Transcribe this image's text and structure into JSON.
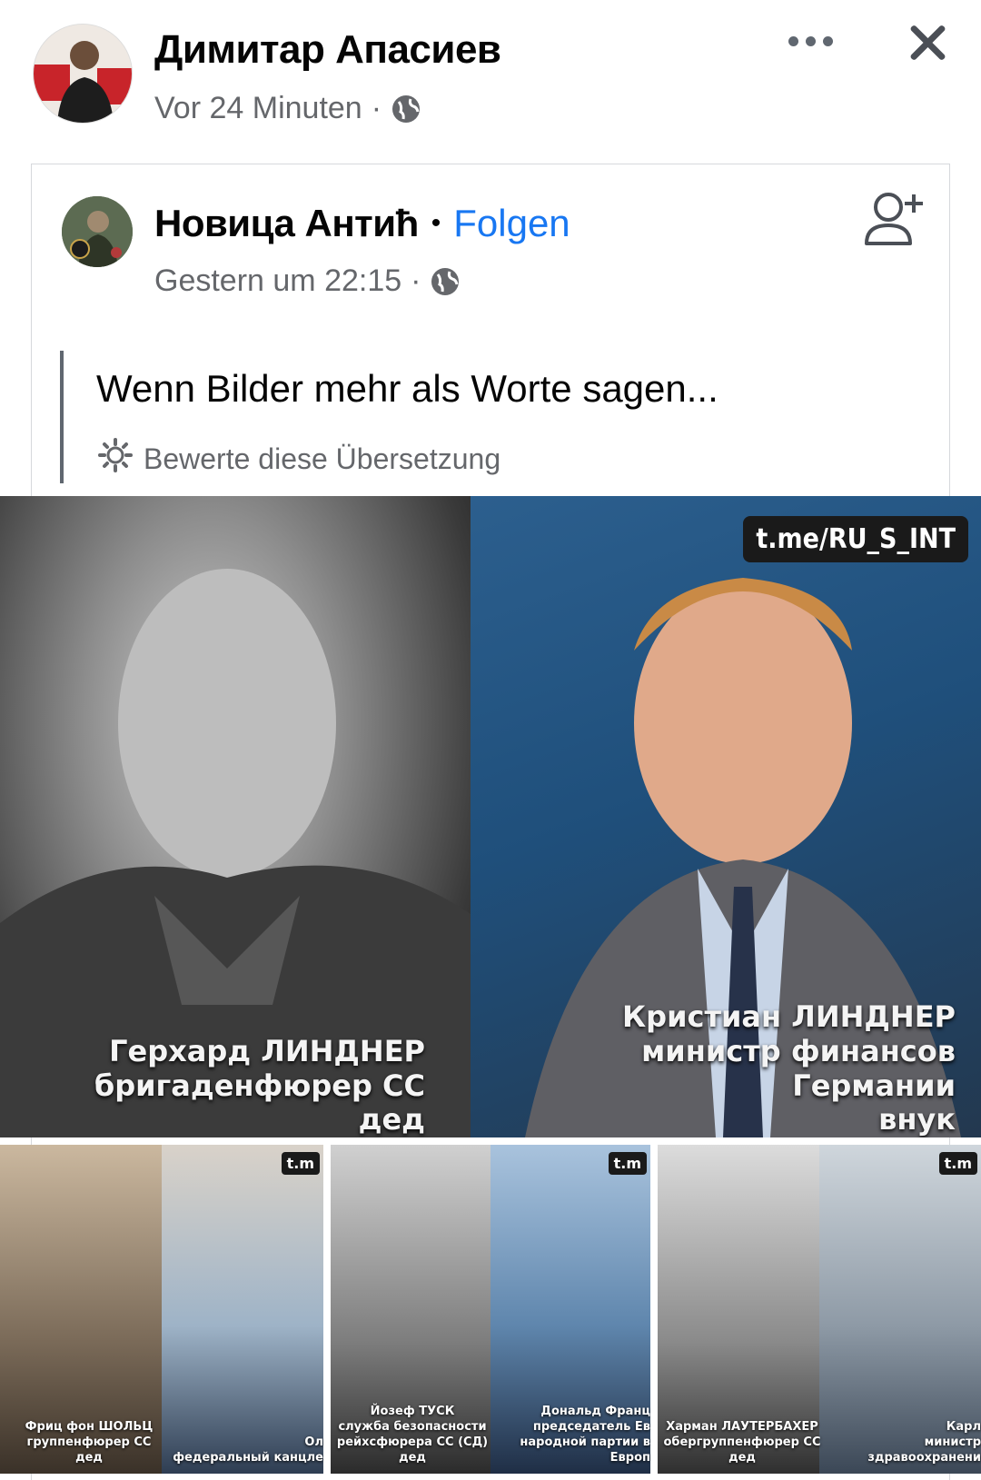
{
  "post": {
    "author": "Димитар Апасиев",
    "time": "Vor 24 Minuten",
    "audience_icon": "globe-icon",
    "more_icon": "more-dots-icon",
    "close_icon": "close-icon"
  },
  "shared": {
    "author": "Новица Антић",
    "separator": "•",
    "follow_label": "Folgen",
    "time": "Gestern um 22:15",
    "audience_icon": "globe-icon",
    "add_friend_icon": "add-friend-icon",
    "text": "Wenn Bilder mehr als Worte sagen...",
    "rate_translation": "Bewerte diese Übersetzung"
  },
  "main_image": {
    "watermark": "t.me/RU_S_INT",
    "left_caption": [
      "Герхард ЛИНДНЕР",
      "бригаденфюрер СС",
      "дед"
    ],
    "right_caption": [
      "Кристиан ЛИНДНЕР",
      "министр финансов Германии",
      "внук"
    ]
  },
  "thumbnails": [
    {
      "tag": "t.m",
      "left_caption": [
        "Фриц фон ШОЛЬЦ",
        "группенфюрер СС",
        "дед"
      ],
      "right_caption": [
        "Ол",
        "федеральный канцле"
      ]
    },
    {
      "tag": "t.m",
      "left_caption": [
        "Йозеф ТУСК",
        "служба безопасности",
        "рейхсфюрера СС (СД)",
        "дед"
      ],
      "right_caption": [
        "Дональд Франц",
        "председатель Ев",
        "народной партии в Европ"
      ]
    },
    {
      "tag": "t.m",
      "left_caption": [
        "Харман ЛАУТЕРБАХЕР",
        "обергруппенфюрер СС",
        "дед"
      ],
      "right_caption": [
        "Карл",
        "министр здравоохранени"
      ]
    }
  ]
}
